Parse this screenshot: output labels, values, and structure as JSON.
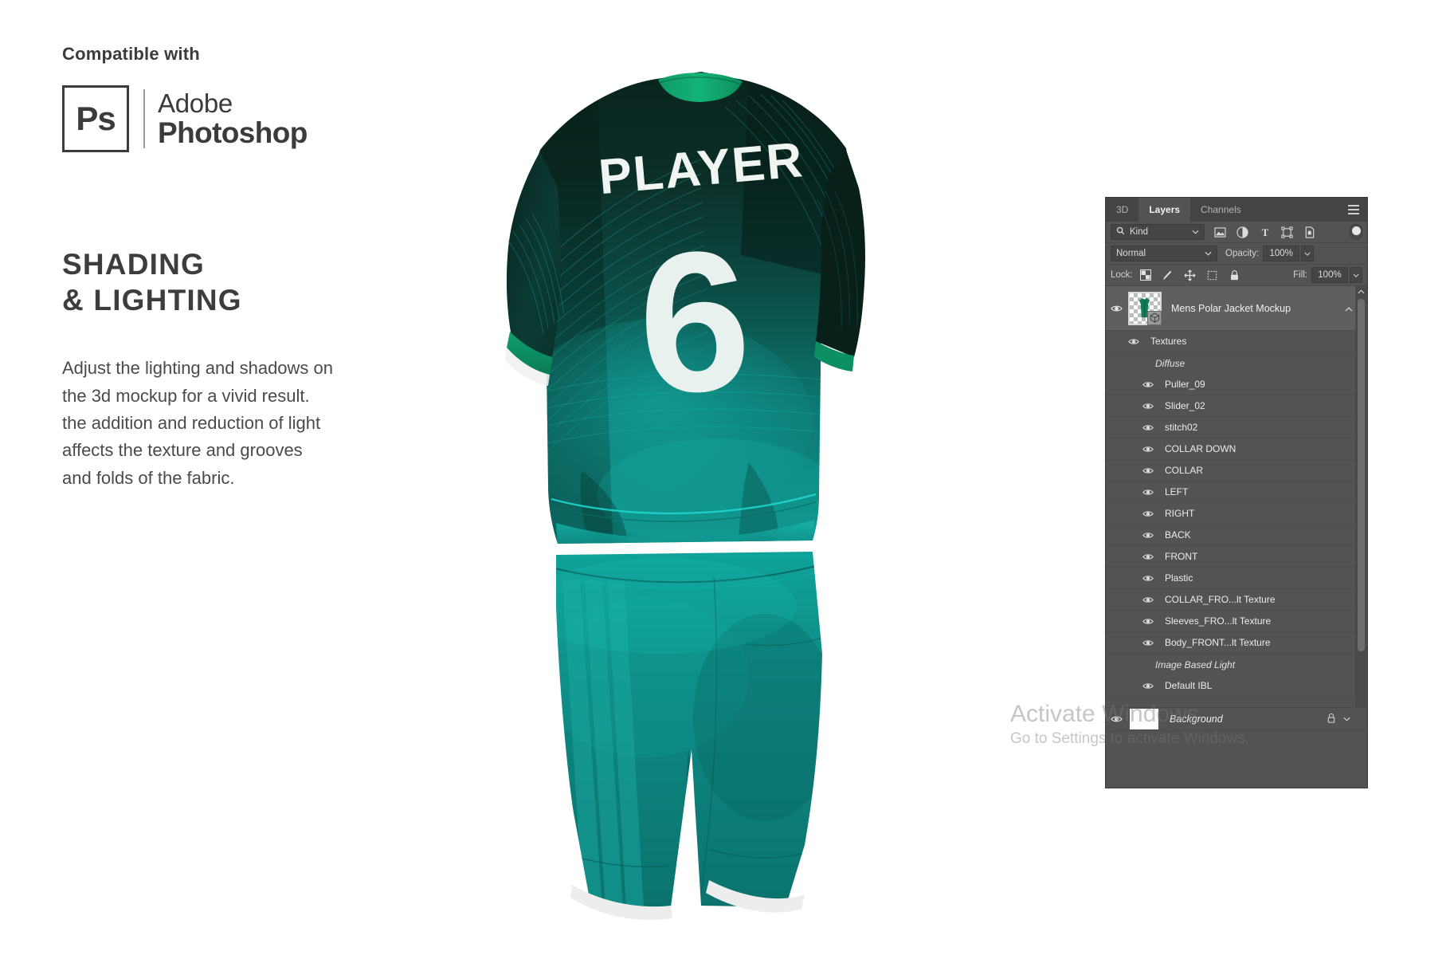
{
  "left_panel": {
    "compatible_label": "Compatible with",
    "logo": {
      "badge_text": "Ps",
      "brand_line1": "Adobe",
      "brand_line2": "Photoshop"
    },
    "heading_line1": "SHADING",
    "heading_line2": "& LIGHTING",
    "body_line1": "Adjust the lighting and shadows on",
    "body_line2": "the 3d mockup for a vivid result.",
    "body_line3": "the addition and reduction of light",
    "body_line4": "affects the texture and grooves",
    "body_line5": "and folds of the fabric."
  },
  "mockup": {
    "player_name": "PLAYER",
    "player_number": "6",
    "colors": {
      "jersey_dark": "#0b2b24",
      "jersey_mid": "#0c6b63",
      "jersey_teal": "#0d8b85",
      "collar_green": "#12a06a",
      "shorts_teal": "#0e7f7a",
      "accent_cyan": "#1fd4d0"
    }
  },
  "ps_panel": {
    "tabs": [
      {
        "label": "3D",
        "active": false
      },
      {
        "label": "Layers",
        "active": true
      },
      {
        "label": "Channels",
        "active": false
      }
    ],
    "menu_icon": "hamburger-icon",
    "filter": {
      "search_icon": "search-icon",
      "kind_label": "Kind",
      "icons": [
        "image-filter-icon",
        "adjustment-filter-icon",
        "type-filter-icon",
        "shape-filter-icon",
        "smart-object-filter-icon"
      ],
      "toggle": "filter-enable-toggle"
    },
    "blend": {
      "mode": "Normal",
      "opacity_label": "Opacity:",
      "opacity_value": "100%"
    },
    "lock": {
      "label": "Lock:",
      "icons": [
        "lock-transparent-pixels-icon",
        "lock-image-pixels-icon",
        "lock-position-icon",
        "lock-artboard-icon",
        "lock-all-icon"
      ],
      "fill_label": "Fill:",
      "fill_value": "100%"
    },
    "layers": [
      {
        "name": "Mens Polar Jacket Mockup",
        "type": "smart-object",
        "indent": 0,
        "visible": true,
        "selected": true
      },
      {
        "name": "Textures",
        "type": "group",
        "indent": 1,
        "visible": true,
        "selected": false
      },
      {
        "name": "Diffuse",
        "type": "italic-heading",
        "indent": 2,
        "visible": false,
        "selected": false
      },
      {
        "name": "Puller_09",
        "type": "layer",
        "indent": 3,
        "visible": true,
        "selected": false
      },
      {
        "name": "Slider_02",
        "type": "layer",
        "indent": 3,
        "visible": true,
        "selected": false
      },
      {
        "name": "stitch02",
        "type": "layer",
        "indent": 3,
        "visible": true,
        "selected": false
      },
      {
        "name": "COLLAR DOWN",
        "type": "layer",
        "indent": 3,
        "visible": true,
        "selected": false
      },
      {
        "name": "COLLAR",
        "type": "layer",
        "indent": 3,
        "visible": true,
        "selected": false
      },
      {
        "name": "LEFT",
        "type": "layer",
        "indent": 3,
        "visible": true,
        "selected": false
      },
      {
        "name": "RIGHT",
        "type": "layer",
        "indent": 3,
        "visible": true,
        "selected": false
      },
      {
        "name": "BACK",
        "type": "layer",
        "indent": 3,
        "visible": true,
        "selected": false
      },
      {
        "name": "FRONT",
        "type": "layer",
        "indent": 3,
        "visible": true,
        "selected": false
      },
      {
        "name": "Plastic",
        "type": "layer",
        "indent": 3,
        "visible": true,
        "selected": false
      },
      {
        "name": "COLLAR_FRO...lt Texture",
        "type": "layer",
        "indent": 3,
        "visible": true,
        "selected": false
      },
      {
        "name": "Sleeves_FRO...lt Texture",
        "type": "layer",
        "indent": 3,
        "visible": true,
        "selected": false
      },
      {
        "name": "Body_FRONT...lt Texture",
        "type": "layer",
        "indent": 3,
        "visible": true,
        "selected": false
      },
      {
        "name": "Image Based Light",
        "type": "italic-heading",
        "indent": 2,
        "visible": false,
        "selected": false
      },
      {
        "name": "Default IBL",
        "type": "layer",
        "indent": 3,
        "visible": true,
        "selected": false
      }
    ],
    "background_layer": {
      "name": "Background",
      "visible": true,
      "locked": true,
      "lock_icon": "lock-icon"
    },
    "scrollbar": {
      "up_icon": "chevron-up-icon",
      "down_icon": "chevron-down-icon"
    }
  },
  "watermark": {
    "title": "Activate Windows",
    "subtitle": "Go to Settings to activate Windows."
  }
}
